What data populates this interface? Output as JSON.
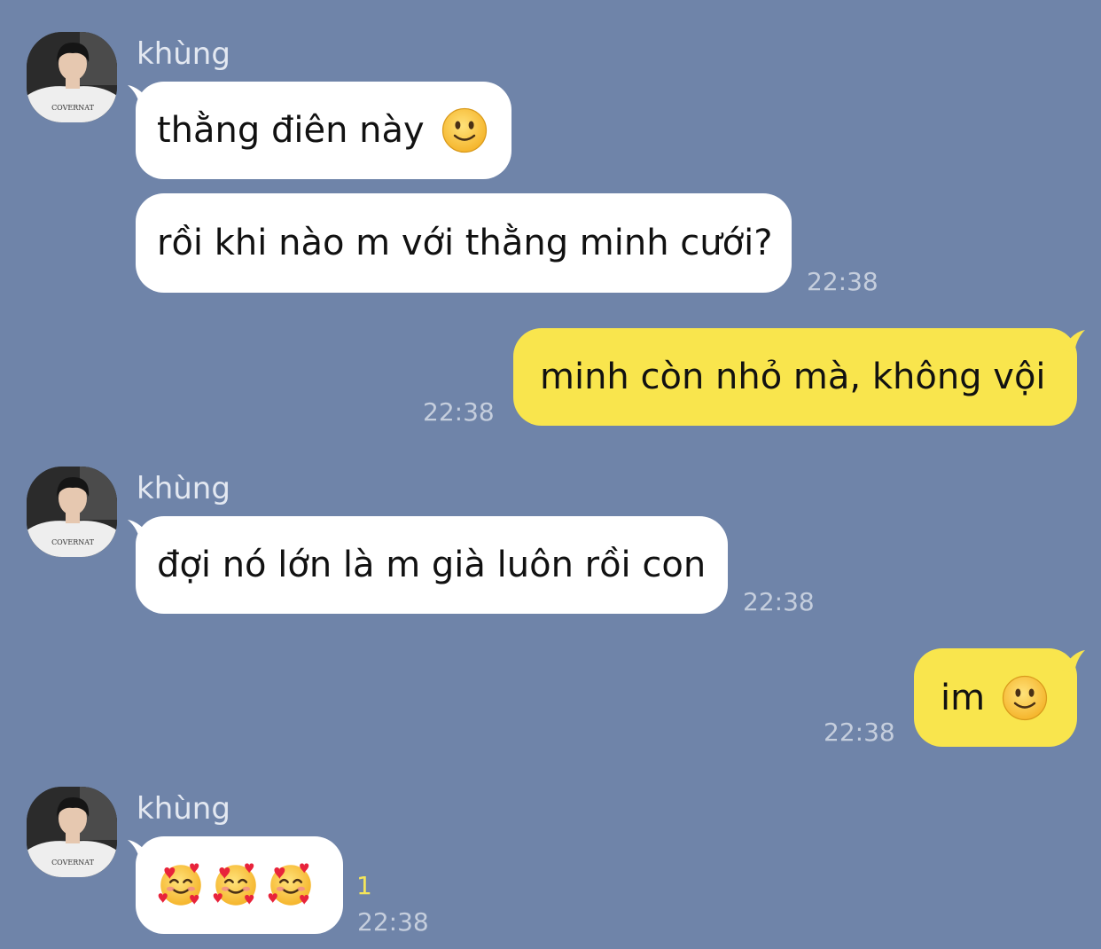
{
  "chat": {
    "messages": [
      {
        "sender": "khùng",
        "text": "thằng điên này",
        "emoji": "slightly-smiling-face-icon"
      },
      {
        "text": "rồi khi nào m với thằng minh cưới?",
        "time": "22:38"
      },
      {
        "text": "minh còn nhỏ mà, không vội",
        "time": "22:38"
      },
      {
        "sender": "khùng",
        "text": "đợi nó lớn là m già luôn rồi con",
        "time": "22:38"
      },
      {
        "text": "im",
        "emoji": "slightly-smiling-face-icon",
        "time": "22:38"
      },
      {
        "sender": "khùng",
        "emojis": [
          "smiling-face-with-hearts-icon",
          "smiling-face-with-hearts-icon",
          "smiling-face-with-hearts-icon"
        ],
        "unread": "1",
        "time": "22:38"
      }
    ]
  },
  "avatar_print": "COVERNAT",
  "colors": {
    "background": "#6f84a9",
    "incoming_bubble": "#ffffff",
    "outgoing_bubble": "#f9e54d",
    "timestamp": "#c5cedd",
    "unread": "#f4e55a"
  }
}
